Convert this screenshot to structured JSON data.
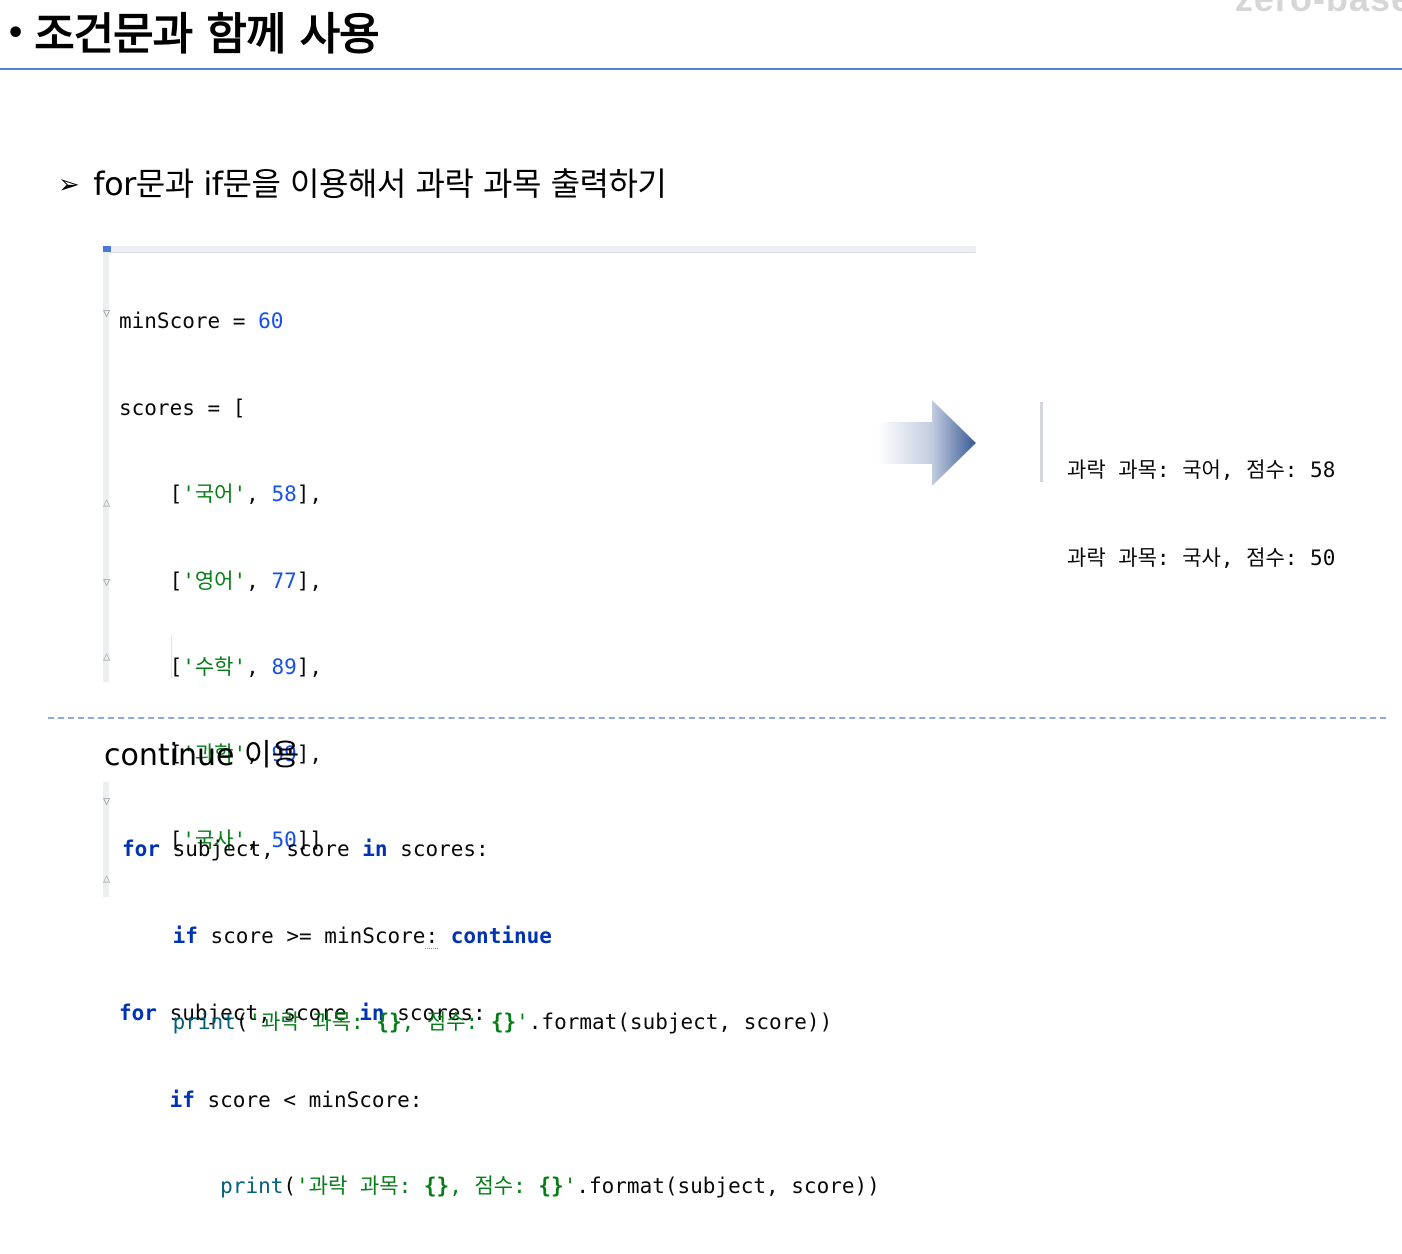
{
  "brand": "zero-base",
  "title": {
    "bullet": "•",
    "text": "조건문과 함께 사용"
  },
  "subheading": {
    "marker": "➢",
    "text": "for문과 if문을 이용해서 과락 과목 출력하기"
  },
  "code_block_1": [
    [
      "minScore ",
      "= ",
      "60"
    ],
    [
      "scores = ["
    ],
    [
      "    [",
      "'국어'",
      ", ",
      "58",
      "],"
    ],
    [
      "    [",
      "'영어'",
      ", ",
      "77",
      "],"
    ],
    [
      "    [",
      "'수학'",
      ", ",
      "89",
      "],"
    ],
    [
      "    [",
      "'과학'",
      ", ",
      "99",
      "],"
    ],
    [
      "    [",
      "'국사'",
      ", ",
      "50",
      "]]"
    ],
    [
      ""
    ],
    [
      "for",
      " subject, score ",
      "in",
      " scores:"
    ],
    [
      "    ",
      "if",
      " score < minScore:"
    ],
    [
      "        ",
      "print",
      "(",
      "'과락 과목: ",
      "{}",
      ", 점수: ",
      "{}",
      "'",
      ".format(subject, score))"
    ]
  ],
  "output": {
    "lines": [
      "과락 과목: 국어, 점수: 58",
      "과락 과목: 국사, 점수: 50"
    ]
  },
  "continue_section": {
    "label": "continue 이용",
    "code": [
      [
        "for",
        " subject, score ",
        "in",
        " scores:"
      ],
      [
        "    ",
        "if",
        " score >= minScore",
        ":",
        " ",
        "continue"
      ],
      [
        "    ",
        "print",
        "(",
        "'과락 과목: ",
        "{}",
        ", 점수: ",
        "{}",
        "'",
        ".format(subject, score))"
      ]
    ]
  },
  "colors": {
    "keyword": "#0033b3",
    "number": "#1750eb",
    "string": "#067d17",
    "function": "#00627a",
    "title_rule": "#5b7fd6",
    "dashed_rule": "#8fa8d8",
    "arrow": "#3a5a96"
  }
}
